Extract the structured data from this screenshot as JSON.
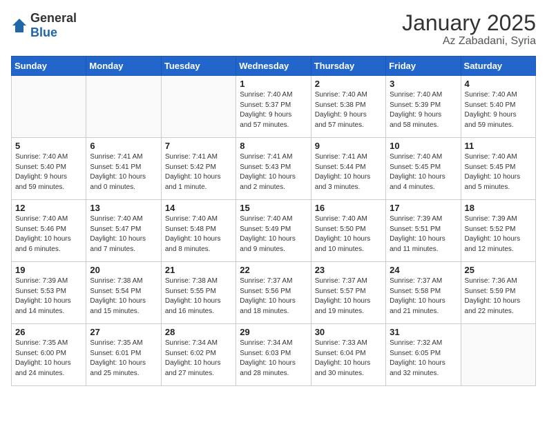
{
  "logo": {
    "general": "General",
    "blue": "Blue"
  },
  "title": "January 2025",
  "subtitle": "Az Zabadani, Syria",
  "days_of_week": [
    "Sunday",
    "Monday",
    "Tuesday",
    "Wednesday",
    "Thursday",
    "Friday",
    "Saturday"
  ],
  "weeks": [
    [
      {
        "day": "",
        "info": ""
      },
      {
        "day": "",
        "info": ""
      },
      {
        "day": "",
        "info": ""
      },
      {
        "day": "1",
        "info": "Sunrise: 7:40 AM\nSunset: 5:37 PM\nDaylight: 9 hours\nand 57 minutes."
      },
      {
        "day": "2",
        "info": "Sunrise: 7:40 AM\nSunset: 5:38 PM\nDaylight: 9 hours\nand 57 minutes."
      },
      {
        "day": "3",
        "info": "Sunrise: 7:40 AM\nSunset: 5:39 PM\nDaylight: 9 hours\nand 58 minutes."
      },
      {
        "day": "4",
        "info": "Sunrise: 7:40 AM\nSunset: 5:40 PM\nDaylight: 9 hours\nand 59 minutes."
      }
    ],
    [
      {
        "day": "5",
        "info": "Sunrise: 7:40 AM\nSunset: 5:40 PM\nDaylight: 9 hours\nand 59 minutes."
      },
      {
        "day": "6",
        "info": "Sunrise: 7:41 AM\nSunset: 5:41 PM\nDaylight: 10 hours\nand 0 minutes."
      },
      {
        "day": "7",
        "info": "Sunrise: 7:41 AM\nSunset: 5:42 PM\nDaylight: 10 hours\nand 1 minute."
      },
      {
        "day": "8",
        "info": "Sunrise: 7:41 AM\nSunset: 5:43 PM\nDaylight: 10 hours\nand 2 minutes."
      },
      {
        "day": "9",
        "info": "Sunrise: 7:41 AM\nSunset: 5:44 PM\nDaylight: 10 hours\nand 3 minutes."
      },
      {
        "day": "10",
        "info": "Sunrise: 7:40 AM\nSunset: 5:45 PM\nDaylight: 10 hours\nand 4 minutes."
      },
      {
        "day": "11",
        "info": "Sunrise: 7:40 AM\nSunset: 5:45 PM\nDaylight: 10 hours\nand 5 minutes."
      }
    ],
    [
      {
        "day": "12",
        "info": "Sunrise: 7:40 AM\nSunset: 5:46 PM\nDaylight: 10 hours\nand 6 minutes."
      },
      {
        "day": "13",
        "info": "Sunrise: 7:40 AM\nSunset: 5:47 PM\nDaylight: 10 hours\nand 7 minutes."
      },
      {
        "day": "14",
        "info": "Sunrise: 7:40 AM\nSunset: 5:48 PM\nDaylight: 10 hours\nand 8 minutes."
      },
      {
        "day": "15",
        "info": "Sunrise: 7:40 AM\nSunset: 5:49 PM\nDaylight: 10 hours\nand 9 minutes."
      },
      {
        "day": "16",
        "info": "Sunrise: 7:40 AM\nSunset: 5:50 PM\nDaylight: 10 hours\nand 10 minutes."
      },
      {
        "day": "17",
        "info": "Sunrise: 7:39 AM\nSunset: 5:51 PM\nDaylight: 10 hours\nand 11 minutes."
      },
      {
        "day": "18",
        "info": "Sunrise: 7:39 AM\nSunset: 5:52 PM\nDaylight: 10 hours\nand 12 minutes."
      }
    ],
    [
      {
        "day": "19",
        "info": "Sunrise: 7:39 AM\nSunset: 5:53 PM\nDaylight: 10 hours\nand 14 minutes."
      },
      {
        "day": "20",
        "info": "Sunrise: 7:38 AM\nSunset: 5:54 PM\nDaylight: 10 hours\nand 15 minutes."
      },
      {
        "day": "21",
        "info": "Sunrise: 7:38 AM\nSunset: 5:55 PM\nDaylight: 10 hours\nand 16 minutes."
      },
      {
        "day": "22",
        "info": "Sunrise: 7:37 AM\nSunset: 5:56 PM\nDaylight: 10 hours\nand 18 minutes."
      },
      {
        "day": "23",
        "info": "Sunrise: 7:37 AM\nSunset: 5:57 PM\nDaylight: 10 hours\nand 19 minutes."
      },
      {
        "day": "24",
        "info": "Sunrise: 7:37 AM\nSunset: 5:58 PM\nDaylight: 10 hours\nand 21 minutes."
      },
      {
        "day": "25",
        "info": "Sunrise: 7:36 AM\nSunset: 5:59 PM\nDaylight: 10 hours\nand 22 minutes."
      }
    ],
    [
      {
        "day": "26",
        "info": "Sunrise: 7:35 AM\nSunset: 6:00 PM\nDaylight: 10 hours\nand 24 minutes."
      },
      {
        "day": "27",
        "info": "Sunrise: 7:35 AM\nSunset: 6:01 PM\nDaylight: 10 hours\nand 25 minutes."
      },
      {
        "day": "28",
        "info": "Sunrise: 7:34 AM\nSunset: 6:02 PM\nDaylight: 10 hours\nand 27 minutes."
      },
      {
        "day": "29",
        "info": "Sunrise: 7:34 AM\nSunset: 6:03 PM\nDaylight: 10 hours\nand 28 minutes."
      },
      {
        "day": "30",
        "info": "Sunrise: 7:33 AM\nSunset: 6:04 PM\nDaylight: 10 hours\nand 30 minutes."
      },
      {
        "day": "31",
        "info": "Sunrise: 7:32 AM\nSunset: 6:05 PM\nDaylight: 10 hours\nand 32 minutes."
      },
      {
        "day": "",
        "info": ""
      }
    ]
  ]
}
